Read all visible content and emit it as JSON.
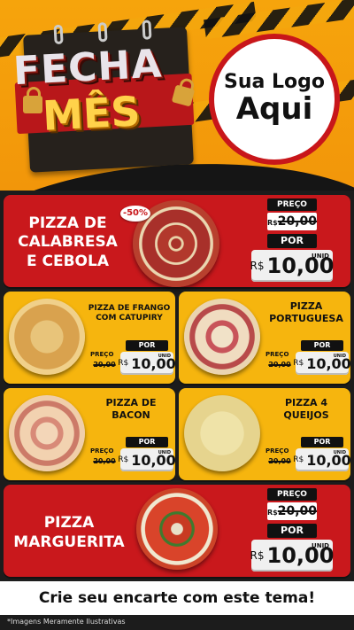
{
  "header": {
    "title_line1": "FECHA",
    "title_line2": "MÊS",
    "logo_line1": "Sua Logo",
    "logo_line2": "Aqui"
  },
  "colors": {
    "red": "#c9181c",
    "yellow": "#f6b50e",
    "dark": "#1c1c1c",
    "orange": "#f6a40c"
  },
  "labels": {
    "preco": "PREÇO",
    "por": "POR",
    "currency": "R$",
    "unid": "UNID"
  },
  "items": [
    {
      "name_l1": "PIZZA DE",
      "name_l2": "CALABRESA",
      "name_l3": "E CEBOLA",
      "old_price": "20,00",
      "new_price": "10,00",
      "badge": "-50%"
    },
    {
      "name_l1": "PIZZA DE FRANGO",
      "name_l2": "COM CATUPIRY",
      "old_price": "20,00",
      "new_price": "10,00"
    },
    {
      "name_l1": "PIZZA",
      "name_l2": "PORTUGUESA",
      "old_price": "20,00",
      "new_price": "10,00"
    },
    {
      "name_l1": "PIZZA DE",
      "name_l2": "BACON",
      "old_price": "20,00",
      "new_price": "10,00"
    },
    {
      "name_l1": "PIZZA 4",
      "name_l2": "QUEIJOS",
      "old_price": "20,00",
      "new_price": "10,00"
    },
    {
      "name_l1": "PIZZA",
      "name_l2": "MARGUERITA",
      "old_price": "20,00",
      "new_price": "10,00"
    }
  ],
  "cta": "Crie seu encarte com este tema!",
  "footnote": "*Imagens Meramente Ilustrativas"
}
